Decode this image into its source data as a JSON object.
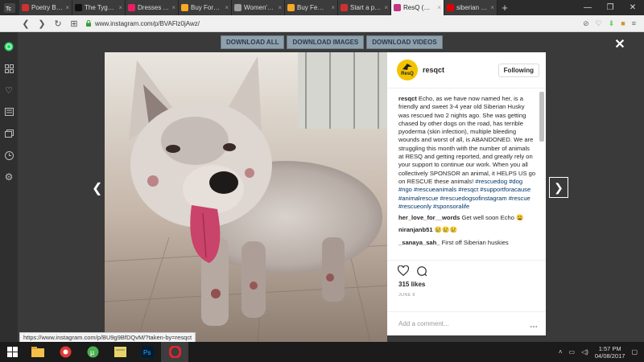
{
  "browser": {
    "tabs": [
      {
        "label": "Poetry By H",
        "color": "#d32f2f",
        "active": false
      },
      {
        "label": "The Tyger b",
        "color": "#111111",
        "active": false
      },
      {
        "label": "Dresses And",
        "color": "#e91e63",
        "active": false
      },
      {
        "label": "Buy Forever",
        "color": "#f9a825",
        "active": false
      },
      {
        "label": "Women's d",
        "color": "#9e9e9e",
        "active": false
      },
      {
        "label": "Buy Femelle",
        "color": "#f9a825",
        "active": false
      },
      {
        "label": "Start a petit",
        "color": "#d32f2f",
        "active": false
      },
      {
        "label": "ResQ (@res",
        "color": "#c13584",
        "active": true
      },
      {
        "label": "siberian hus",
        "color": "#e00000",
        "active": false
      }
    ],
    "url": "www.instagram.com/p/BVAFlz0jAwz/",
    "status_url": "https://www.instagram.com/p/BU9g9BfDQvM/?taken-by=resqct"
  },
  "toolbar": {
    "buttons": [
      "DOWNLOAD ALL",
      "DOWNLOAD IMAGES",
      "DOWNLOAD VIDEOS"
    ]
  },
  "post": {
    "avatar_text": "ResQ",
    "username": "resqct",
    "follow_label": "Following",
    "caption_user": "resqct",
    "caption_text": "Echo, as we have now named her, is a friendly and sweet 3-4 year old Siberian Husky was rescued two 2 nights ago. She was getting chased by other dogs on the road, has terrible pyoderma (skin infection), multiple bleeding wounds and worst of all, is ABANDONED. We are struggling this month with the number of animals at RESQ and getting reported, and greatly rely on your support to continue our work. When you all collectively SPONSOR an animal, it HELPS US go on RESCUE these animals!",
    "hashtags": "#rescuedog #dog #ngo #rescueanimals #resqct #supportforacause #animalrescue #rescuedogsofinstagram #rescue #rescueonly #sponsoralife",
    "comments": [
      {
        "user": "her_love_for__words",
        "text": "Get well soon Echo 😩"
      },
      {
        "user": "niranjanb51",
        "text": "😢😢😢"
      },
      {
        "user": "_sanaya_sah_",
        "text": "First off Siberian huskies"
      }
    ],
    "likes": "315 likes",
    "date": "JUNE 8",
    "add_comment_placeholder": "Add a comment...",
    "more_label": "..."
  },
  "taskbar": {
    "time": "1:57 PM",
    "date": "04/08/2017"
  }
}
